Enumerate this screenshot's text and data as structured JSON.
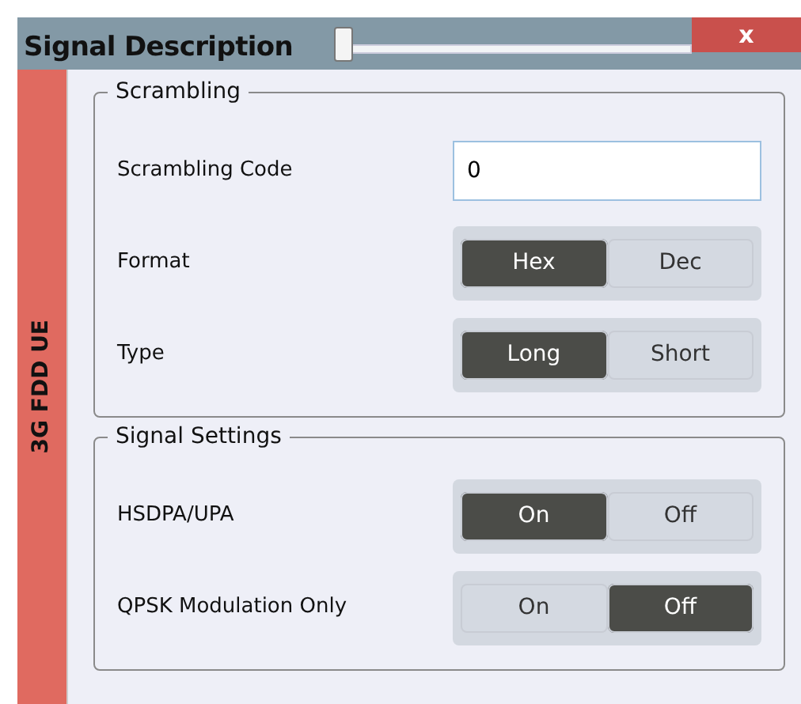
{
  "window": {
    "title": "Signal Description",
    "close": "x",
    "slider": {
      "level": 0
    }
  },
  "side_tab": {
    "label": "3G FDD UE"
  },
  "groups": [
    {
      "title": "Scrambling",
      "rows": [
        {
          "kind": "field",
          "label": "Scrambling Code",
          "value": "0"
        },
        {
          "kind": "toggle",
          "label": "Format",
          "options": [
            {
              "label": "Hex",
              "selected": true
            },
            {
              "label": "Dec",
              "selected": false
            }
          ]
        },
        {
          "kind": "toggle",
          "label": "Type",
          "options": [
            {
              "label": "Long",
              "selected": true
            },
            {
              "label": "Short",
              "selected": false
            }
          ]
        }
      ]
    },
    {
      "title": "Signal Settings",
      "rows": [
        {
          "kind": "toggle",
          "label": "HSDPA/UPA",
          "options": [
            {
              "label": "On",
              "selected": true
            },
            {
              "label": "Off",
              "selected": false
            }
          ]
        },
        {
          "kind": "toggle",
          "label": "QPSK Modulation Only",
          "options": [
            {
              "label": "On",
              "selected": false
            },
            {
              "label": "Off",
              "selected": true
            }
          ]
        }
      ]
    }
  ]
}
